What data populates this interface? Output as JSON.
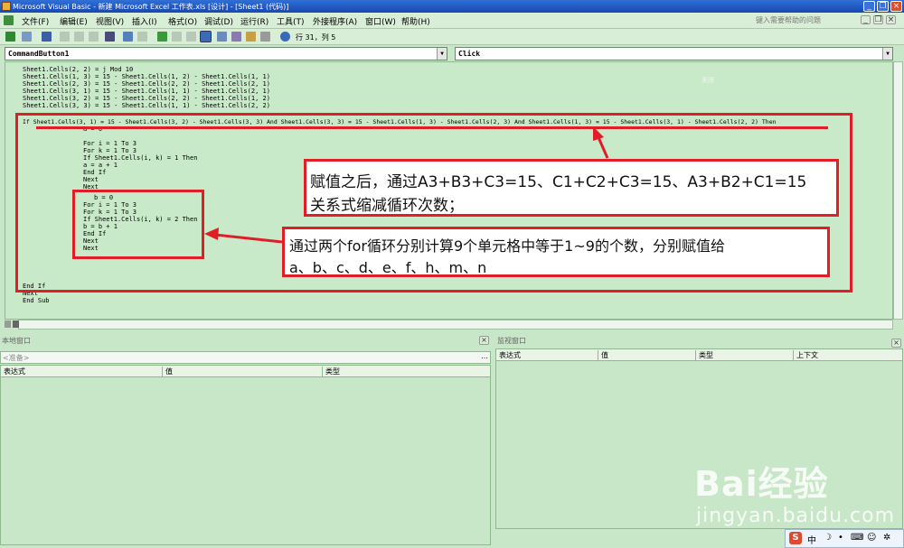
{
  "window": {
    "title": "Microsoft Visual Basic - 新建 Microsoft Excel 工作表.xls [设计] - [Sheet1 (代码)]"
  },
  "menubar": {
    "items": [
      "文件(F)",
      "编辑(E)",
      "视图(V)",
      "插入(I)",
      "格式(O)",
      "调试(D)",
      "运行(R)",
      "工具(T)",
      "外接程序(A)",
      "窗口(W)",
      "帮助(H)"
    ],
    "help_placeholder": "键入需要帮助的问题"
  },
  "toolbar": {
    "position": "行 31，列 5"
  },
  "code": {
    "object_combo": "CommandButton1",
    "procedure_combo": "Click",
    "lines": [
      "Sheet1.Cells(2, 2) = j Mod 10",
      "Sheet1.Cells(1, 3) = 15 - Sheet1.Cells(1, 2) - Sheet1.Cells(1, 1)",
      "Sheet1.Cells(2, 3) = 15 - Sheet1.Cells(2, 2) - Sheet1.Cells(2, 1)",
      "Sheet1.Cells(3, 1) = 15 - Sheet1.Cells(1, 1) - Sheet1.Cells(2, 1)",
      "Sheet1.Cells(3, 2) = 15 - Sheet1.Cells(2, 2) - Sheet1.Cells(1, 2)",
      "Sheet1.Cells(3, 3) = 15 - Sheet1.Cells(1, 1) - Sheet1.Cells(2, 2)",
      "If Sheet1.Cells(3, 1) = 15 - Sheet1.Cells(3, 2) - Sheet1.Cells(3, 3) And Sheet1.Cells(3, 3) = 15 - Sheet1.Cells(1, 3) - Sheet1.Cells(2, 3) And Sheet1.Cells(1, 3) = 15 - Sheet1.Cells(3, 1) - Sheet1.Cells(2, 2) Then",
      "a = 0",
      "For i = 1 To 3",
      "For k = 1 To 3",
      "If Sheet1.Cells(i, k) = 1 Then",
      "a = a + 1",
      "End If",
      "Next",
      "Next",
      "b = 0",
      "For i = 1 To 3",
      "For k = 1 To 3",
      "If Sheet1.Cells(i, k) = 2 Then",
      "b = b + 1",
      "End If",
      "Next",
      "Next",
      "End If",
      "Next",
      "End Sub"
    ],
    "ghost_label": "关闭"
  },
  "annotations": {
    "callout1_line1": "赋值之后，通过A3+B3+C3=15、C1+C2+C3=15、A3+B2+C1=15",
    "callout1_line2": "关系式缩减循环次数；",
    "callout2_line1": "通过两个for循环分别计算9个单元格中等于1~9的个数，分别赋值给",
    "callout2_line2": "a、b、c、d、e、f、h、m、n",
    "color": "#e01e28"
  },
  "locals": {
    "title": "本地窗口",
    "status": "<准备>",
    "columns": [
      "表达式",
      "值",
      "类型"
    ]
  },
  "watch": {
    "title": "监视窗口",
    "columns": [
      "表达式",
      "值",
      "类型",
      "上下文"
    ]
  },
  "watermark": {
    "brand": "Bai经验",
    "url": "jingyan.baidu.com"
  },
  "tray": {
    "ime": "中"
  }
}
